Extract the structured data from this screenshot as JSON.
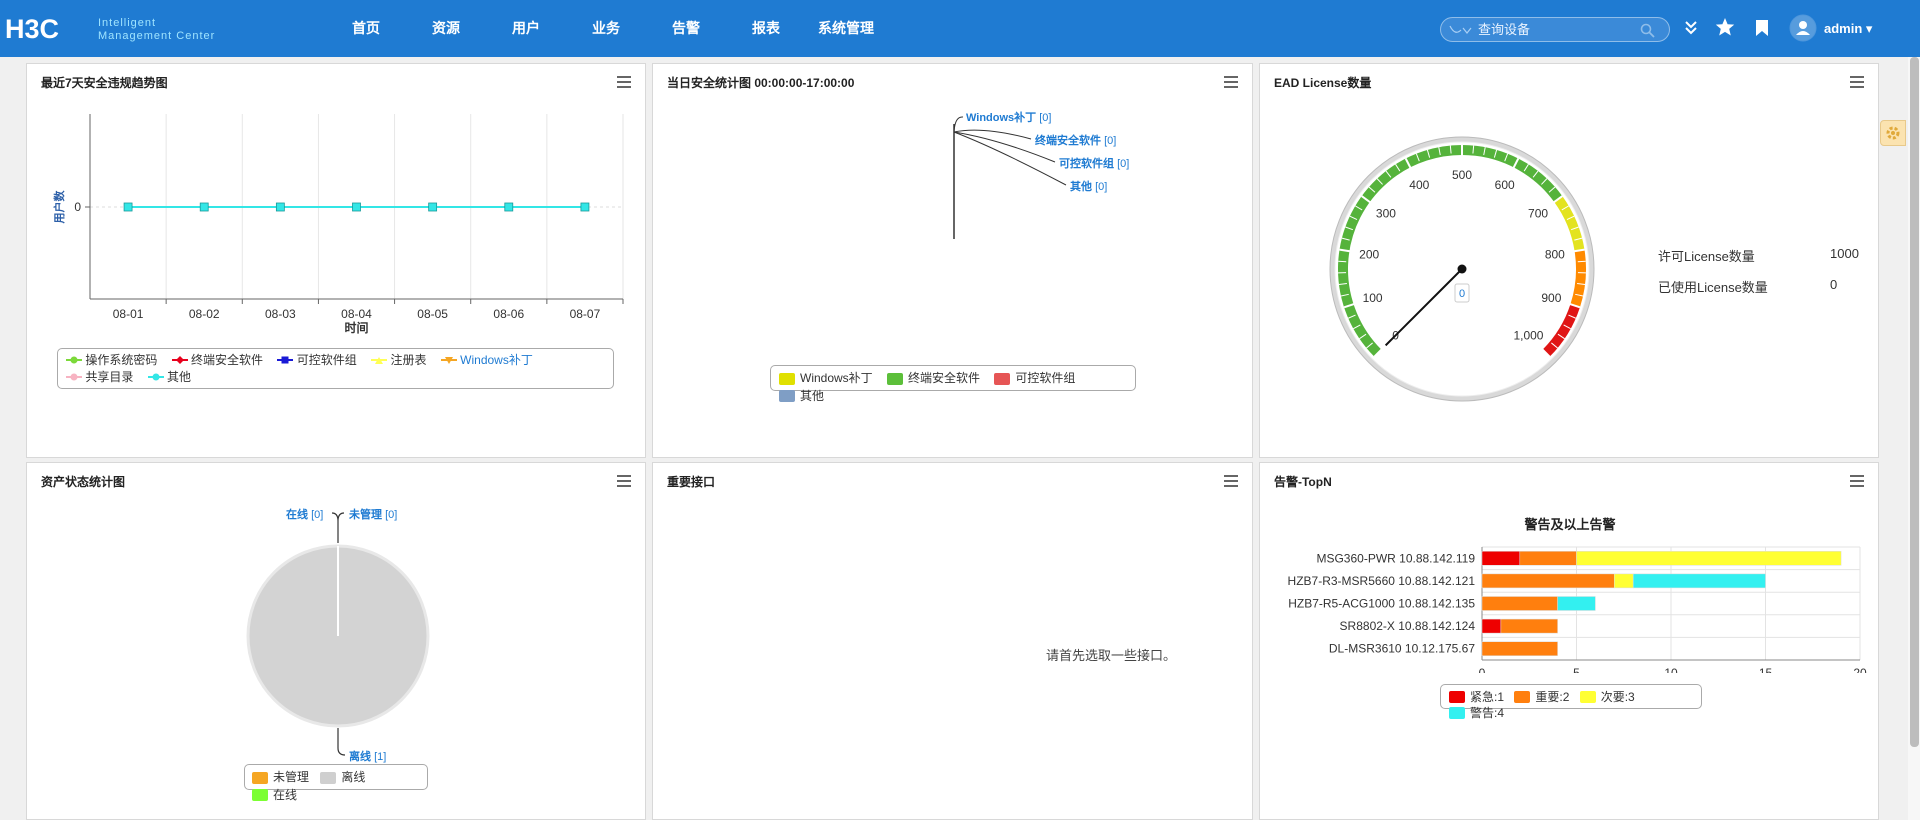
{
  "header": {
    "logo_text": "H3C",
    "logo_sub1": "Intelligent",
    "logo_sub2": "Management Center",
    "nav": [
      "首页",
      "资源",
      "用户",
      "业务",
      "告警",
      "报表",
      "系统管理"
    ],
    "search_placeholder": "查询设备",
    "user": "admin"
  },
  "panels": {
    "trend": {
      "title": "最近7天安全违规趋势图",
      "ylabel": "用户数",
      "xlabel": "时间",
      "legend": [
        "操作系统密码",
        "终端安全软件",
        "可控软件组",
        "注册表",
        "Windows补丁",
        "共享目录",
        "其他"
      ],
      "legend_colors": [
        "#7cd93a",
        "#e8001c",
        "#1a1ad6",
        "#ffff55",
        "#f5a623",
        "#f7b3c2",
        "#33e6e6"
      ]
    },
    "daily": {
      "title": "当日安全统计图 00:00:00-17:00:00",
      "labels": [
        "Windows补丁",
        "终端安全软件",
        "可控软件组",
        "其他"
      ],
      "values": [
        "[0]",
        "[0]",
        "[0]",
        "[0]"
      ],
      "legend": [
        "Windows补丁",
        "终端安全软件",
        "可控软件组",
        "其他"
      ],
      "legend_colors": [
        "#e0e000",
        "#5cbf3a",
        "#e65555",
        "#7f9ec5"
      ]
    },
    "license": {
      "title": "EAD License数量",
      "gauge_value": "0",
      "ticks": [
        "0",
        "100",
        "200",
        "300",
        "400",
        "500",
        "600",
        "700",
        "800",
        "900",
        "1,000"
      ],
      "licensed_label": "许可License数量",
      "licensed_value": "1000",
      "used_label": "已使用License数量",
      "used_value": "0"
    },
    "asset": {
      "title": "资产状态统计图",
      "label_online": "在线",
      "label_online_val": "[0]",
      "label_unmanaged": "未管理",
      "label_unmanaged_val": "[0]",
      "label_offline": "离线",
      "label_offline_val": "[1]",
      "legend": [
        "未管理",
        "离线",
        "在线"
      ],
      "legend_colors": [
        "#f5a623",
        "#cfcfcf",
        "#7cff33"
      ]
    },
    "iface": {
      "title": "重要接口",
      "message": "请首先选取一些接口。"
    },
    "alarm": {
      "title": "告警-TopN",
      "legend": [
        "紧急:1",
        "重要:2",
        "次要:3",
        "警告:4"
      ],
      "legend_colors": [
        "#ee0000",
        "#ff7f0e",
        "#ffff33",
        "#33f0f0"
      ]
    }
  },
  "chart_data": [
    {
      "type": "line",
      "title": "最近7天安全违规趋势图",
      "xlabel": "时间",
      "ylabel": "用户数",
      "categories": [
        "08-01",
        "08-02",
        "08-03",
        "08-04",
        "08-05",
        "08-06",
        "08-07"
      ],
      "series": [
        {
          "name": "操作系统密码",
          "values": [
            0,
            0,
            0,
            0,
            0,
            0,
            0
          ]
        },
        {
          "name": "终端安全软件",
          "values": [
            0,
            0,
            0,
            0,
            0,
            0,
            0
          ]
        },
        {
          "name": "可控软件组",
          "values": [
            0,
            0,
            0,
            0,
            0,
            0,
            0
          ]
        },
        {
          "name": "注册表",
          "values": [
            0,
            0,
            0,
            0,
            0,
            0,
            0
          ]
        },
        {
          "name": "Windows补丁",
          "values": [
            0,
            0,
            0,
            0,
            0,
            0,
            0
          ]
        },
        {
          "name": "共享目录",
          "values": [
            0,
            0,
            0,
            0,
            0,
            0,
            0
          ]
        },
        {
          "name": "其他",
          "values": [
            0,
            0,
            0,
            0,
            0,
            0,
            0
          ]
        }
      ],
      "yticks": [
        "0"
      ]
    },
    {
      "type": "pie",
      "title": "当日安全统计图 00:00:00-17:00:00",
      "categories": [
        "Windows补丁",
        "终端安全软件",
        "可控软件组",
        "其他"
      ],
      "values": [
        0,
        0,
        0,
        0
      ]
    },
    {
      "type": "pie",
      "title": "资产状态统计图",
      "categories": [
        "在线",
        "未管理",
        "离线"
      ],
      "values": [
        0,
        0,
        1
      ]
    },
    {
      "type": "bar",
      "title": "警告及以上告警",
      "orientation": "horizontal-stacked",
      "categories": [
        "MSG360-PWR 10.88.142.119",
        "HZB7-R3-MSR5660 10.88.142.121",
        "HZB7-R5-ACG1000 10.88.142.135",
        "SR8802-X 10.88.142.124",
        "DL-MSR3610 10.12.175.67"
      ],
      "series": [
        {
          "name": "紧急:1",
          "values": [
            2,
            0,
            0,
            1,
            0
          ]
        },
        {
          "name": "重要:2",
          "values": [
            3,
            7,
            4,
            3,
            4
          ]
        },
        {
          "name": "次要:3",
          "values": [
            14,
            1,
            0,
            0,
            0
          ]
        },
        {
          "name": "警告:4",
          "values": [
            0,
            7,
            2,
            0,
            0
          ]
        }
      ],
      "xlim": [
        0,
        20
      ],
      "xticks": [
        0,
        5,
        10,
        15,
        20
      ]
    }
  ]
}
